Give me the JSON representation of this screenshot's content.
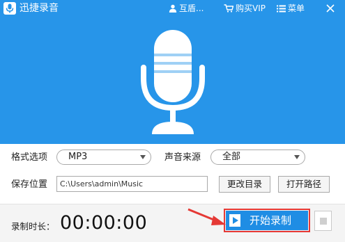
{
  "app": {
    "title": "迅捷录音"
  },
  "titlebar": {
    "user_label": "互盾...",
    "vip_label": "购买VIP",
    "menu_label": "菜单"
  },
  "settings": {
    "format_label": "格式选项",
    "format_value": "MP3",
    "source_label": "声音来源",
    "source_value": "全部",
    "save_label": "保存位置",
    "save_path": "C:\\Users\\admin\\Music",
    "change_dir_label": "更改目录",
    "open_path_label": "打开路径"
  },
  "record": {
    "duration_label": "录制时长：",
    "duration_value": "00:00:00",
    "start_label": "开始录制"
  },
  "colors": {
    "brand_blue": "#2795e9",
    "button_blue": "#1f8de4",
    "annotation_red": "#e53935"
  },
  "icons": {
    "logo": "mic-logo-icon",
    "user": "user-icon",
    "vip": "cart-icon",
    "menu": "menu-icon",
    "close": "close-icon",
    "hero": "microphone-icon",
    "play": "play-icon",
    "stop": "stop-icon"
  }
}
